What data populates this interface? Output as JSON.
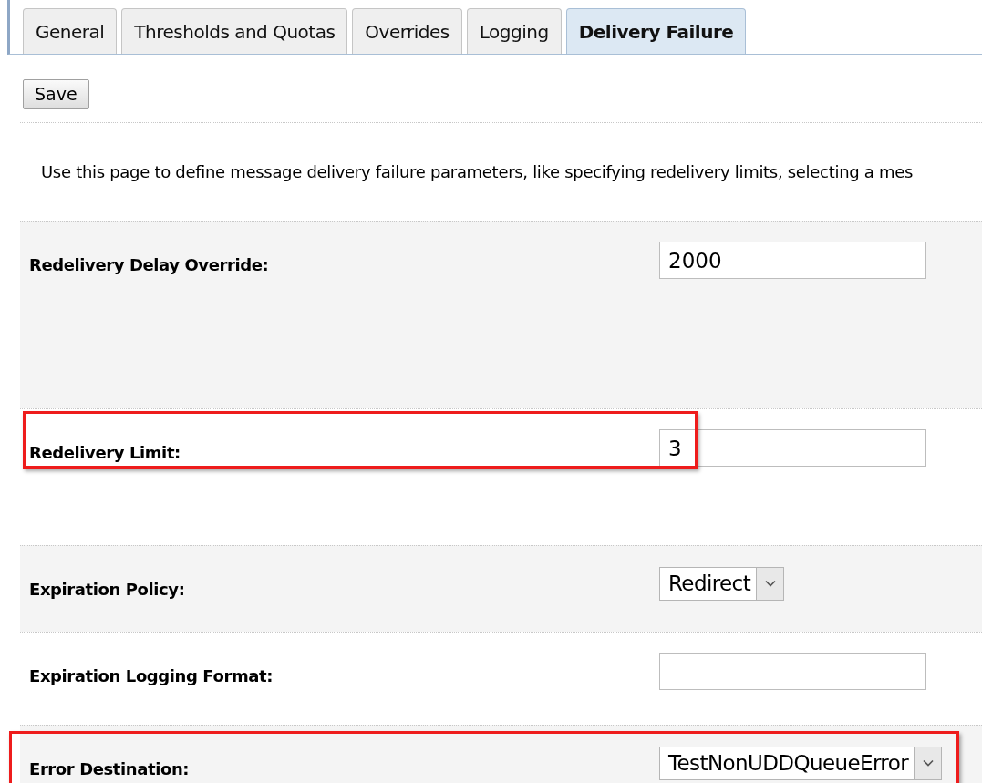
{
  "tabs": [
    {
      "label": "General",
      "selected": false
    },
    {
      "label": "Thresholds and Quotas",
      "selected": false
    },
    {
      "label": "Overrides",
      "selected": false
    },
    {
      "label": "Logging",
      "selected": false
    },
    {
      "label": "Delivery Failure",
      "selected": true
    }
  ],
  "save_button": "Save",
  "description": "Use this page to define message delivery failure parameters, like specifying redelivery limits, selecting a mes",
  "fields": [
    {
      "label": "Redelivery Delay Override:",
      "kind": "text",
      "value": "2000",
      "shaded": true,
      "highlighted": false
    },
    {
      "label": "Redelivery Limit:",
      "kind": "text",
      "value": "3",
      "shaded": false,
      "highlighted": true,
      "highlight_wide": false
    },
    {
      "label": "Expiration Policy:",
      "kind": "select",
      "value": "Redirect",
      "shaded": true,
      "highlighted": false
    },
    {
      "label": "Expiration Logging Format:",
      "kind": "text",
      "shaded": false,
      "highlighted": false
    },
    {
      "label": "Error Destination:",
      "kind": "select",
      "value": "TestNonUDDQueueError",
      "shaded": true,
      "highlighted": true,
      "highlight_wide": true
    }
  ]
}
